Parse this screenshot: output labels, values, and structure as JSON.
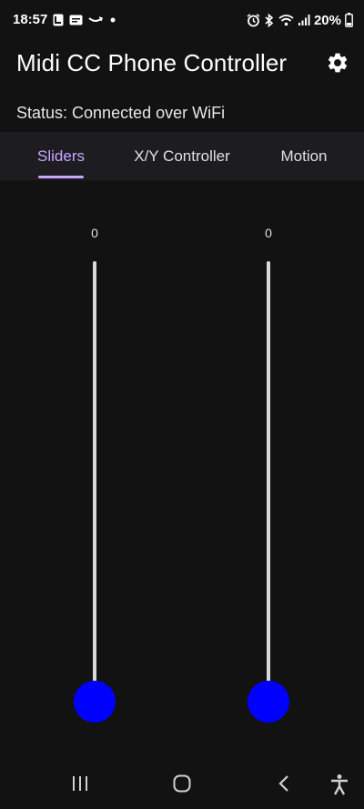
{
  "status_bar": {
    "time": "18:57",
    "battery_percent": "20%",
    "left_icons": [
      "notification-app-icon",
      "message-icon",
      "amazon-icon",
      "dot-icon"
    ],
    "right_icons": [
      "alarm-icon",
      "bluetooth-icon",
      "wifi-icon",
      "signal-icon",
      "battery-icon"
    ]
  },
  "app_bar": {
    "title": "Midi CC Phone Controller",
    "settings_icon": "gear-icon"
  },
  "status": {
    "text": "Status: Connected over WiFi"
  },
  "tabs": [
    {
      "label": "Sliders",
      "active": true
    },
    {
      "label": "X/Y Controller",
      "active": false
    },
    {
      "label": "Motion",
      "active": false
    }
  ],
  "sliders": [
    {
      "value": "0",
      "level": 0
    },
    {
      "value": "0",
      "level": 0
    }
  ],
  "colors": {
    "background": "#121212",
    "tab_bar": "#1d1c21",
    "accent": "#c9a6ff",
    "thumb": "#0000ff",
    "track": "#d9d9d9"
  },
  "nav_bar": {
    "buttons": [
      "recent-apps-icon",
      "home-icon",
      "back-icon",
      "accessibility-icon"
    ]
  }
}
